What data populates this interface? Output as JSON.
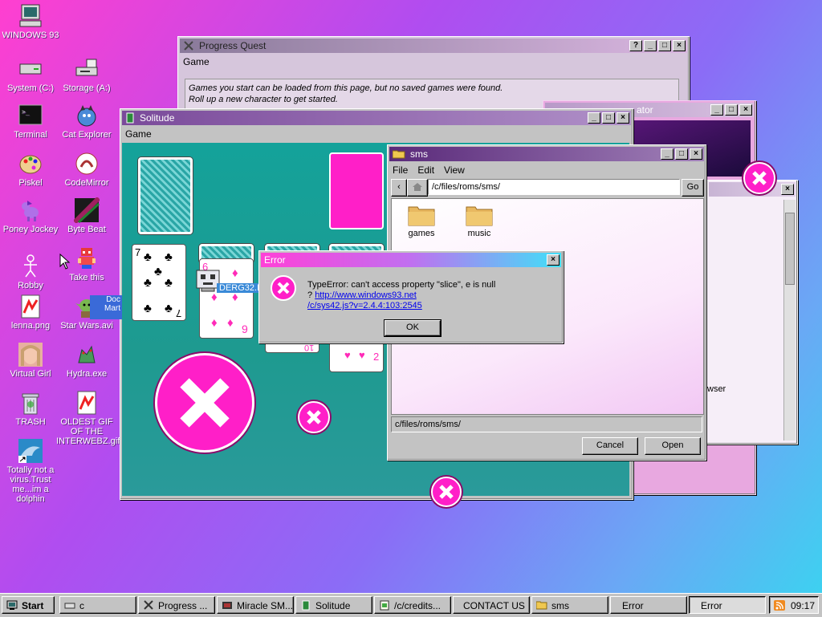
{
  "desktop": {
    "icons": [
      {
        "label": "WINDOWS 93"
      },
      {
        "label": "System (C:)"
      },
      {
        "label": "Storage (A:)"
      },
      {
        "label": "Terminal"
      },
      {
        "label": "Cat Explorer"
      },
      {
        "label": "Piskel"
      },
      {
        "label": "CodeMirror"
      },
      {
        "label": "Poney Jockey"
      },
      {
        "label": "Byte Beat"
      },
      {
        "label": "Robby"
      },
      {
        "label": "Take this"
      },
      {
        "label": "lenna.png"
      },
      {
        "label": "Star Wars.avi"
      },
      {
        "label": "Virtual Girl"
      },
      {
        "label": "Hydra.exe"
      },
      {
        "label": "TRASH"
      },
      {
        "label": "OLDEST GIF OF THE INTERWEBZ.gif"
      },
      {
        "label": "Totally not a virus.Trust me...im a dolphin"
      },
      {
        "label": "Doc Mart"
      },
      {
        "label": "DERG32.EXE"
      }
    ]
  },
  "progress_quest": {
    "title": "Progress Quest",
    "menu": [
      "Game"
    ],
    "message_line1": "Games you start can be loaded from this page, but no saved games were found.",
    "message_line2": "Roll up a new character to get started."
  },
  "background_window": {
    "title_fragment": "ator"
  },
  "third_window": {
    "text_fragment": "wser"
  },
  "solitude": {
    "title": "Solitude",
    "menu": [
      "Game"
    ],
    "cards": {
      "seven": "7",
      "six": "6",
      "nine": "9",
      "ten": "10",
      "two": "2"
    }
  },
  "sms": {
    "title": "sms",
    "menu": [
      "File",
      "Edit",
      "View"
    ],
    "path": "/c/files/roms/sms/",
    "go": "Go",
    "folders": [
      {
        "label": "games"
      },
      {
        "label": "music"
      }
    ],
    "status_path": "c/files/roms/sms/",
    "cancel": "Cancel",
    "open": "Open"
  },
  "error_dialog": {
    "title": "Error",
    "message": "TypeError: can't access property \"slice\", e is null",
    "prefix": "? ",
    "link1": "http://www.windows93.net",
    "link2": "/c/sys42.js?v=2.4.4:103:2545",
    "ok": "OK"
  },
  "taskbar": {
    "start": "Start",
    "items": [
      {
        "label": "c"
      },
      {
        "label": "Progress ..."
      },
      {
        "label": "Miracle SM..."
      },
      {
        "label": "Solitude"
      },
      {
        "label": "/c/credits..."
      },
      {
        "label": "CONTACT US"
      },
      {
        "label": "sms"
      },
      {
        "label": "Error"
      },
      {
        "label": "Error"
      }
    ],
    "clock": "09:17"
  },
  "colors": {
    "accent_pink": "#ff1fc8",
    "felt": "#1aa39a",
    "title_active": "#6a1a8a"
  }
}
